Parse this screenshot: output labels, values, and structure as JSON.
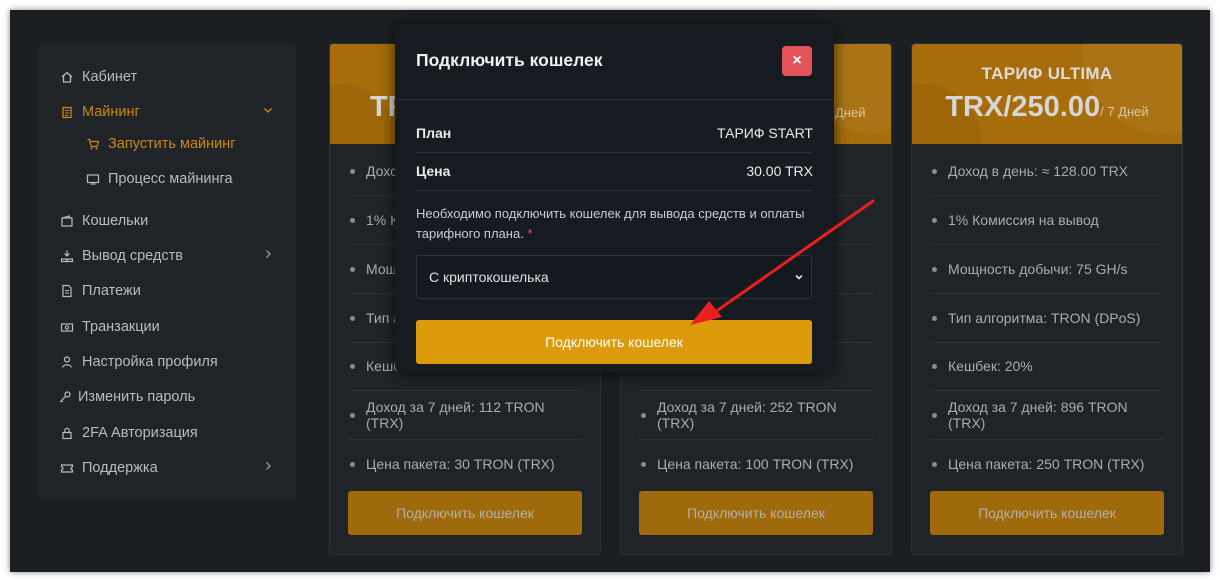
{
  "sidebar": {
    "items": [
      {
        "label": "Кабинет",
        "icon": "home-icon"
      },
      {
        "label": "Майнинг",
        "icon": "clipboard-icon"
      },
      {
        "label": "Запустить майнинг",
        "icon": "cart-icon"
      },
      {
        "label": "Процесс майнинга",
        "icon": "monitor-icon"
      },
      {
        "label": "Кошельки",
        "icon": "wallet-icon"
      },
      {
        "label": "Вывод средств",
        "icon": "withdraw-icon"
      },
      {
        "label": "Платежи",
        "icon": "document-icon"
      },
      {
        "label": "Транзакции",
        "icon": "banknote-icon"
      },
      {
        "label": "Настройка профиля",
        "icon": "user-icon"
      },
      {
        "label": "Изменить пароль",
        "icon": "key-icon"
      },
      {
        "label": "2FA Авторизация",
        "icon": "lock-icon"
      },
      {
        "label": "Поддержка",
        "icon": "ticket-icon"
      }
    ]
  },
  "cards": [
    {
      "title": "",
      "price_partial": "TR",
      "period": "",
      "features": [
        "Дохо",
        "1% Ко",
        "Мощ",
        "Тип а",
        "Кешб",
        "Доход за 7 дней: 112 TRON (TRX)",
        "Цена пакета: 30 TRON (TRX)"
      ],
      "button": "Подключить кошелек"
    },
    {
      "title": "",
      "price_partial": "",
      "period": "Дней",
      "features": [
        "",
        "",
        "",
        "",
        "",
        "Доход за 7 дней: 252 TRON (TRX)",
        "Цена пакета: 100 TRON (TRX)"
      ],
      "button": "Подключить кошелек"
    },
    {
      "title": "ТАРИФ ULTIMA",
      "price": "TRX/250.00",
      "period": "/ 7 Дней",
      "features": [
        "Доход в день: ≈ 128.00 TRX",
        "1% Комиссия на вывод",
        "Мощность добычи: 75 GH/s",
        "Тип алгоритма: TRON (DPoS)",
        "Кешбек: 20%",
        "Доход за 7 дней: 896 TRON (TRX)",
        "Цена пакета: 250 TRON (TRX)"
      ],
      "button": "Подключить кошелек"
    }
  ],
  "modal": {
    "title": "Подключить кошелек",
    "close": "×",
    "plan_label": "План",
    "plan_value": "ТАРИФ START",
    "price_label": "Цена",
    "price_value": "30.00 TRX",
    "note": "Необходимо подключить кошелек для вывода средств и оплаты тарифного плана.",
    "required_mark": "*",
    "select_value": "С криптокошелька",
    "submit": "Подключить кошелек"
  },
  "colors": {
    "accent": "#dd9a0a",
    "close": "#e5535a",
    "annotation_arrow": "#e8201e"
  }
}
